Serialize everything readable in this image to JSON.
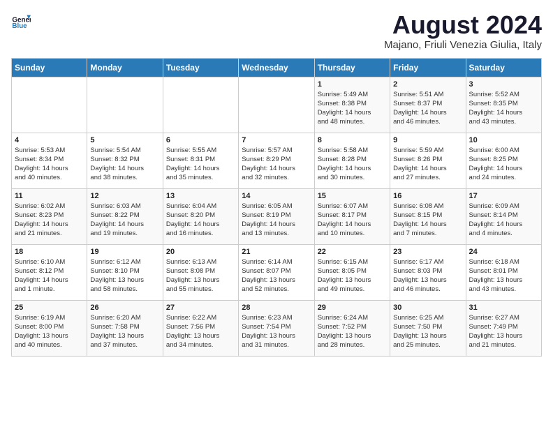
{
  "logo": {
    "line1": "General",
    "line2": "Blue"
  },
  "title": "August 2024",
  "subtitle": "Majano, Friuli Venezia Giulia, Italy",
  "days_of_week": [
    "Sunday",
    "Monday",
    "Tuesday",
    "Wednesday",
    "Thursday",
    "Friday",
    "Saturday"
  ],
  "weeks": [
    [
      {
        "day": "",
        "info": ""
      },
      {
        "day": "",
        "info": ""
      },
      {
        "day": "",
        "info": ""
      },
      {
        "day": "",
        "info": ""
      },
      {
        "day": "1",
        "info": "Sunrise: 5:49 AM\nSunset: 8:38 PM\nDaylight: 14 hours\nand 48 minutes."
      },
      {
        "day": "2",
        "info": "Sunrise: 5:51 AM\nSunset: 8:37 PM\nDaylight: 14 hours\nand 46 minutes."
      },
      {
        "day": "3",
        "info": "Sunrise: 5:52 AM\nSunset: 8:35 PM\nDaylight: 14 hours\nand 43 minutes."
      }
    ],
    [
      {
        "day": "4",
        "info": "Sunrise: 5:53 AM\nSunset: 8:34 PM\nDaylight: 14 hours\nand 40 minutes."
      },
      {
        "day": "5",
        "info": "Sunrise: 5:54 AM\nSunset: 8:32 PM\nDaylight: 14 hours\nand 38 minutes."
      },
      {
        "day": "6",
        "info": "Sunrise: 5:55 AM\nSunset: 8:31 PM\nDaylight: 14 hours\nand 35 minutes."
      },
      {
        "day": "7",
        "info": "Sunrise: 5:57 AM\nSunset: 8:29 PM\nDaylight: 14 hours\nand 32 minutes."
      },
      {
        "day": "8",
        "info": "Sunrise: 5:58 AM\nSunset: 8:28 PM\nDaylight: 14 hours\nand 30 minutes."
      },
      {
        "day": "9",
        "info": "Sunrise: 5:59 AM\nSunset: 8:26 PM\nDaylight: 14 hours\nand 27 minutes."
      },
      {
        "day": "10",
        "info": "Sunrise: 6:00 AM\nSunset: 8:25 PM\nDaylight: 14 hours\nand 24 minutes."
      }
    ],
    [
      {
        "day": "11",
        "info": "Sunrise: 6:02 AM\nSunset: 8:23 PM\nDaylight: 14 hours\nand 21 minutes."
      },
      {
        "day": "12",
        "info": "Sunrise: 6:03 AM\nSunset: 8:22 PM\nDaylight: 14 hours\nand 19 minutes."
      },
      {
        "day": "13",
        "info": "Sunrise: 6:04 AM\nSunset: 8:20 PM\nDaylight: 14 hours\nand 16 minutes."
      },
      {
        "day": "14",
        "info": "Sunrise: 6:05 AM\nSunset: 8:19 PM\nDaylight: 14 hours\nand 13 minutes."
      },
      {
        "day": "15",
        "info": "Sunrise: 6:07 AM\nSunset: 8:17 PM\nDaylight: 14 hours\nand 10 minutes."
      },
      {
        "day": "16",
        "info": "Sunrise: 6:08 AM\nSunset: 8:15 PM\nDaylight: 14 hours\nand 7 minutes."
      },
      {
        "day": "17",
        "info": "Sunrise: 6:09 AM\nSunset: 8:14 PM\nDaylight: 14 hours\nand 4 minutes."
      }
    ],
    [
      {
        "day": "18",
        "info": "Sunrise: 6:10 AM\nSunset: 8:12 PM\nDaylight: 14 hours\nand 1 minute."
      },
      {
        "day": "19",
        "info": "Sunrise: 6:12 AM\nSunset: 8:10 PM\nDaylight: 13 hours\nand 58 minutes."
      },
      {
        "day": "20",
        "info": "Sunrise: 6:13 AM\nSunset: 8:08 PM\nDaylight: 13 hours\nand 55 minutes."
      },
      {
        "day": "21",
        "info": "Sunrise: 6:14 AM\nSunset: 8:07 PM\nDaylight: 13 hours\nand 52 minutes."
      },
      {
        "day": "22",
        "info": "Sunrise: 6:15 AM\nSunset: 8:05 PM\nDaylight: 13 hours\nand 49 minutes."
      },
      {
        "day": "23",
        "info": "Sunrise: 6:17 AM\nSunset: 8:03 PM\nDaylight: 13 hours\nand 46 minutes."
      },
      {
        "day": "24",
        "info": "Sunrise: 6:18 AM\nSunset: 8:01 PM\nDaylight: 13 hours\nand 43 minutes."
      }
    ],
    [
      {
        "day": "25",
        "info": "Sunrise: 6:19 AM\nSunset: 8:00 PM\nDaylight: 13 hours\nand 40 minutes."
      },
      {
        "day": "26",
        "info": "Sunrise: 6:20 AM\nSunset: 7:58 PM\nDaylight: 13 hours\nand 37 minutes."
      },
      {
        "day": "27",
        "info": "Sunrise: 6:22 AM\nSunset: 7:56 PM\nDaylight: 13 hours\nand 34 minutes."
      },
      {
        "day": "28",
        "info": "Sunrise: 6:23 AM\nSunset: 7:54 PM\nDaylight: 13 hours\nand 31 minutes."
      },
      {
        "day": "29",
        "info": "Sunrise: 6:24 AM\nSunset: 7:52 PM\nDaylight: 13 hours\nand 28 minutes."
      },
      {
        "day": "30",
        "info": "Sunrise: 6:25 AM\nSunset: 7:50 PM\nDaylight: 13 hours\nand 25 minutes."
      },
      {
        "day": "31",
        "info": "Sunrise: 6:27 AM\nSunset: 7:49 PM\nDaylight: 13 hours\nand 21 minutes."
      }
    ]
  ]
}
